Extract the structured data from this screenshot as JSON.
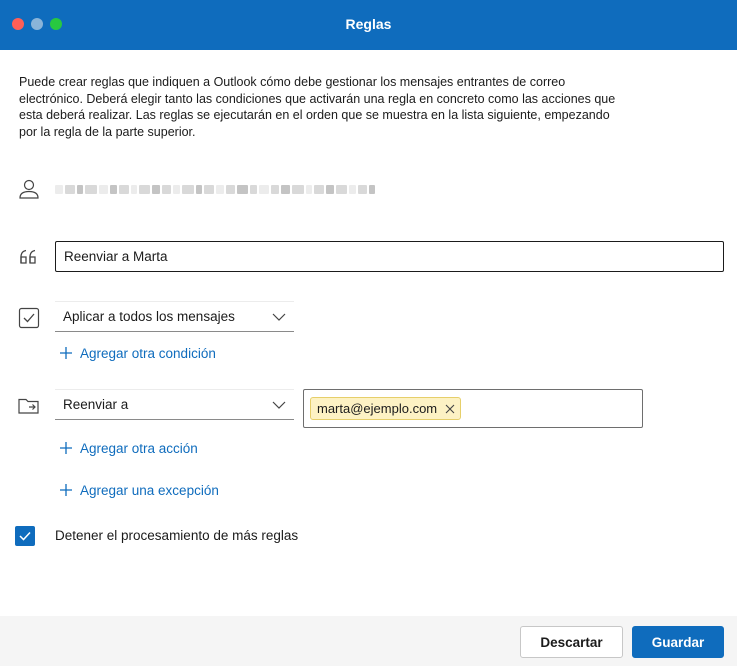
{
  "window": {
    "title": "Reglas"
  },
  "description": "Puede crear reglas que indiquen a Outlook cómo debe gestionar los mensajes entrantes de correo electrónico. Deberá elegir tanto las condiciones que activarán una regla en concreto como las acciones que esta deberá realizar. Las reglas se ejecutarán en el orden que se muestra en la lista siguiente, empezando por la regla de la parte superior.",
  "account": {
    "icon": "person-icon",
    "obscured": true
  },
  "rule_name": {
    "icon": "quote-icon",
    "value": "Reenviar a Marta"
  },
  "condition": {
    "icon": "checkbox-outline-icon",
    "selected": "Aplicar a todos los mensajes",
    "add_label": "Agregar otra condición"
  },
  "action": {
    "icon": "folder-forward-icon",
    "selected": "Reenviar a",
    "recipient": "marta@ejemplo.com",
    "add_label": "Agregar otra acción"
  },
  "exception": {
    "add_label": "Agregar una excepción"
  },
  "stop_processing": {
    "checked": true,
    "label": "Detener el procesamiento de más reglas"
  },
  "footer": {
    "discard_label": "Descartar",
    "save_label": "Guardar"
  },
  "colors": {
    "accent": "#0f6cbd",
    "chip_bg": "#fdf2c4",
    "close": "#ff5f57",
    "maximize": "#28c840"
  }
}
